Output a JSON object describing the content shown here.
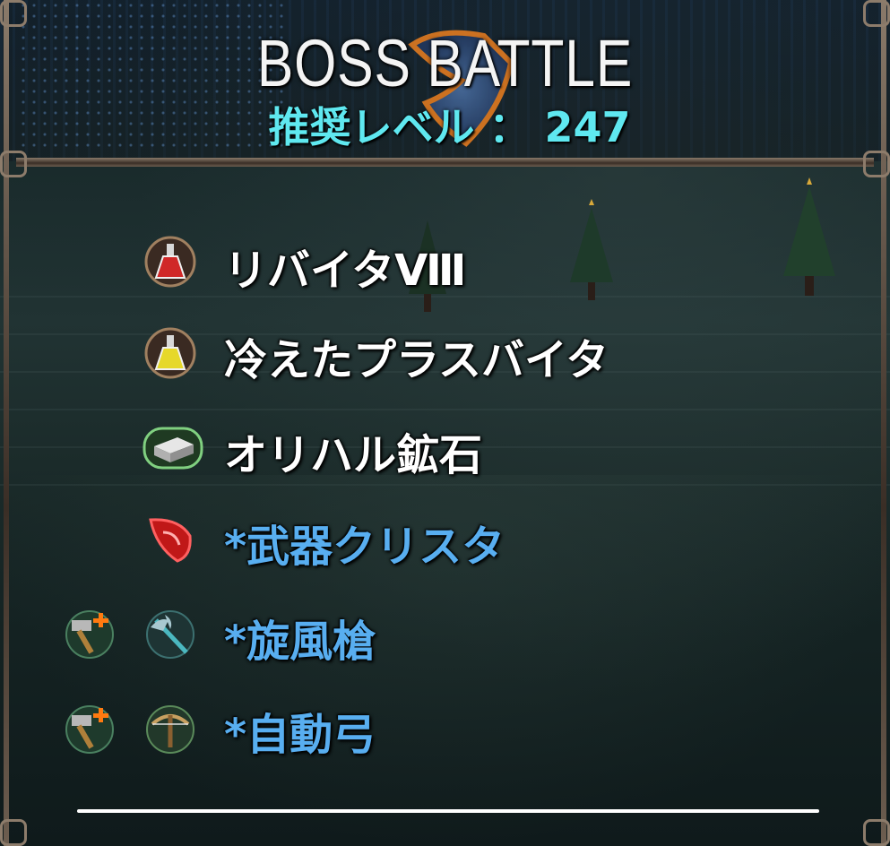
{
  "header": {
    "title": "BOSS BATTLE",
    "recommended_level": "推奨レベル ： 247"
  },
  "drops": [
    {
      "name": "リバイタⅧ",
      "icons": [
        "red-potion-icon"
      ],
      "color": "#ffffff"
    },
    {
      "name": "冷えたプラスバイタ",
      "icons": [
        "yellow-potion-icon"
      ],
      "color": "#ffffff"
    },
    {
      "name": "オリハル鉱石",
      "icons": [
        "ore-ingot-icon"
      ],
      "color": "#ffffff"
    },
    {
      "name": "*武器クリスタ",
      "icons": [
        "red-crystal-icon"
      ],
      "color": "#58aef0"
    },
    {
      "name": "*旋風槍",
      "icons": [
        "craft-hammer-plus-icon",
        "halberd-icon"
      ],
      "color": "#58aef0"
    },
    {
      "name": "*自動弓",
      "icons": [
        "craft-hammer-plus-icon",
        "crossbow-icon"
      ],
      "color": "#58aef0"
    }
  ],
  "colors": {
    "subtitle": "#5fe8f0",
    "rare_item": "#58aef0",
    "normal_item": "#ffffff",
    "frame": "#8d7c6b"
  }
}
